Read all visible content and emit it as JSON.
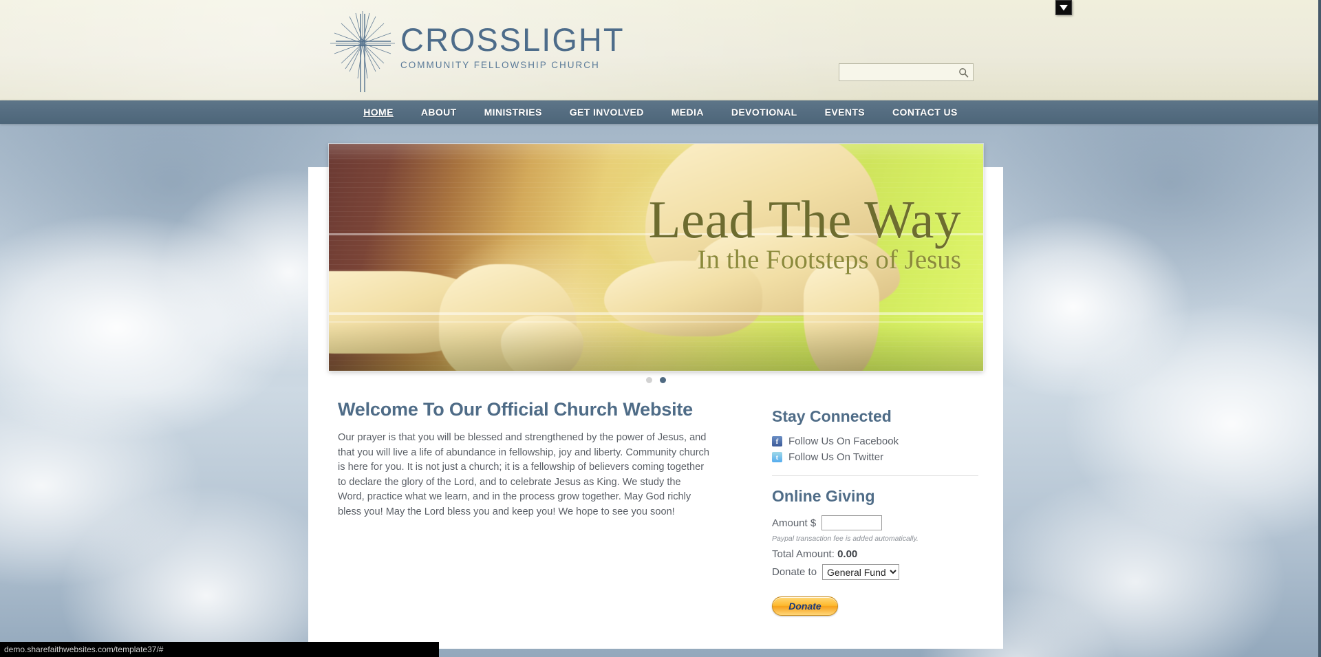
{
  "header": {
    "logo_name": "CROSSLIGHT",
    "logo_sub": "COMMUNITY FELLOWSHIP CHURCH",
    "logo_icon": "radiant-cross-icon",
    "search_placeholder": "",
    "search_value": "",
    "search_icon": "search-icon"
  },
  "nav": {
    "items": [
      {
        "label": "HOME",
        "active": true
      },
      {
        "label": "ABOUT",
        "active": false
      },
      {
        "label": "MINISTRIES",
        "active": false
      },
      {
        "label": "GET INVOLVED",
        "active": false
      },
      {
        "label": "MEDIA",
        "active": false
      },
      {
        "label": "DEVOTIONAL",
        "active": false
      },
      {
        "label": "EVENTS",
        "active": false
      },
      {
        "label": "CONTACT US",
        "active": false
      }
    ]
  },
  "hero": {
    "title": "Lead The Way",
    "subtitle": "In the Footsteps of Jesus",
    "image_description": "adult-hand-holding-child-hand",
    "slides": [
      {
        "index": 1,
        "active": false
      },
      {
        "index": 2,
        "active": true
      }
    ]
  },
  "welcome": {
    "title": "Welcome To Our Official Church Website",
    "body": "Our prayer is that you will be blessed and strengthened by the power of Jesus, and that you will live a life of abundance in fellowship, joy and liberty. Community church is here for you. It is not just a church; it is a fellowship of believers coming together to declare the glory of the Lord, and to celebrate Jesus as King. We study the Word, practice what we learn, and in the process grow together. May God richly bless you! May the Lord bless you and keep you! We hope to see you soon!"
  },
  "stay_connected": {
    "title": "Stay Connected",
    "links": [
      {
        "label": "Follow Us On Facebook",
        "icon": "facebook-icon",
        "glyph": "f"
      },
      {
        "label": "Follow Us On Twitter",
        "icon": "twitter-icon",
        "glyph": "t"
      }
    ]
  },
  "online_giving": {
    "title": "Online Giving",
    "amount_label": "Amount $",
    "amount_value": "",
    "paypal_note": "Paypal transaction fee is added automatically.",
    "total_label": "Total Amount:",
    "total_value": "0.00",
    "donate_to_label": "Donate to",
    "fund_selected": "General Fund",
    "fund_options": [
      "General Fund"
    ],
    "donate_button": "Donate"
  },
  "browser": {
    "status_url": "demo.sharefaithwebsites.com/template37/#",
    "top_right_icon": "chevron-down-icon"
  },
  "colors": {
    "nav_bg": "#546c80",
    "accent_blue": "#4f6c87",
    "header_cream": "#eeedd8",
    "donate_orange": "#fdb82c",
    "hero_title": "#6d6c2f"
  }
}
